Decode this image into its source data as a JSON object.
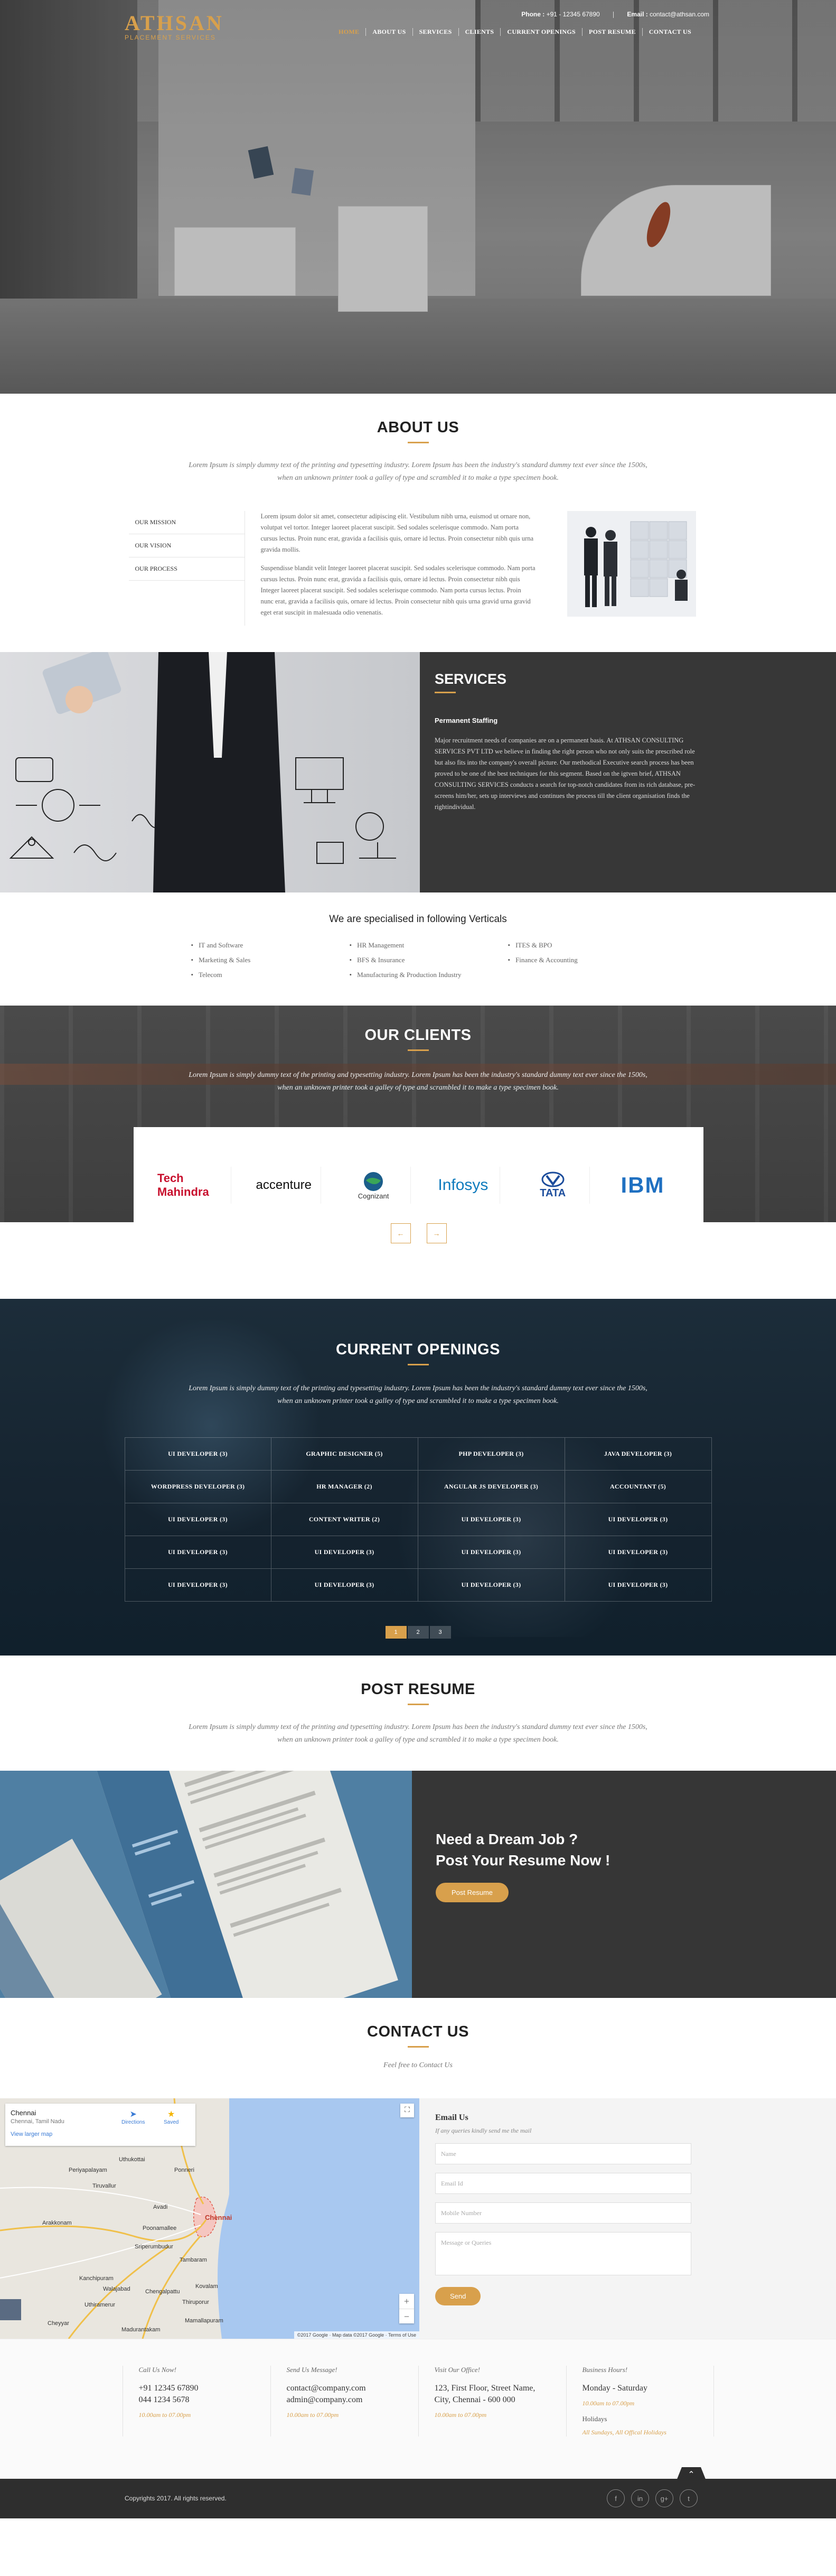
{
  "header": {
    "phone_label": "Phone :",
    "phone": "+91 - 12345 67890",
    "email_label": "Email :",
    "email": "contact@athsan.com",
    "brand": "ATHSAN",
    "tagline": "PLACEMENT SERVICES",
    "nav": [
      "HOME",
      "ABOUT US",
      "SERVICES",
      "CLIENTS",
      "CURRENT OPENINGS",
      "POST RESUME",
      "CONTACT US"
    ]
  },
  "about": {
    "title": "ABOUT US",
    "intro": "Lorem Ipsum is simply dummy text of the printing and typesetting industry. Lorem Ipsum has been the industry's standard dummy text ever since the 1500s, when an unknown printer took a galley of type and scrambled it to make a type specimen book.",
    "tabs": [
      "OUR MISSION",
      "OUR VISION",
      "OUR PROCESS"
    ],
    "para1": "Lorem ipsum dolor sit amet, consectetur adipiscing elit. Vestibulum nibh urna, euismod ut ornare non, volutpat vel tortor. Integer laoreet placerat suscipit. Sed sodales scelerisque commodo. Nam porta cursus lectus. Proin nunc erat, gravida a facilisis quis, ornare id lectus. Proin consectetur nibh quis urna gravida mollis.",
    "para2": "Suspendisse blandit velit Integer laoreet placerat suscipit. Sed sodales scelerisque commodo. Nam porta cursus lectus. Proin nunc erat, gravida a facilisis quis, ornare id lectus. Proin consectetur nibh quis Integer laoreet placerat suscipit. Sed sodales scelerisque commodo. Nam porta cursus lectus. Proin nunc erat, gravida a facilisis quis, ornare id lectus. Proin consectetur nibh quis urna gravid urna gravid eget erat suscipit in malesuada odio venenatis."
  },
  "services": {
    "title": "SERVICES",
    "subtitle": "Permanent Staffing",
    "text": "Major recruitment needs of companies are on a permanent basis. At ATHSAN CONSULTING SERVICES PVT LTD we believe in finding the right person who not only suits the prescribed role but also fits into the company's overall picture. Our methodical Executive search process has been proved to be one of the best techniques for this segment. Based on the  igtven brief, ATHSAN CONSULTING SERVICES conducts a search for top-notch candidates from its rich database, pre-screens him/her, sets up interviews and continues the process till the client organisation finds the rightindividual."
  },
  "verticals": {
    "title": "We are specialised in following Verticals",
    "items": [
      "IT and Software",
      "HR Management",
      "ITES & BPO",
      "Marketing & Sales",
      "BFS & Insurance",
      "Finance & Accounting",
      "Telecom",
      "Manufacturing & Production Industry"
    ]
  },
  "clients": {
    "title": "OUR CLIENTS",
    "intro": "Lorem Ipsum is simply dummy text of the printing and typesetting industry. Lorem Ipsum has been the industry's standard dummy text ever since the 1500s, when an unknown printer took a galley of type and scrambled it to make a type specimen book.",
    "logos": [
      "Tech Mahindra",
      "accenture",
      "Cognizant",
      "Infosys",
      "TATA",
      "IBM"
    ],
    "prev": "←",
    "next": "→"
  },
  "openings": {
    "title": "CURRENT OPENINGS",
    "intro": "Lorem Ipsum is simply dummy text of the printing and typesetting industry. Lorem Ipsum has been the industry's standard dummy text ever since the 1500s, when an unknown printer took a galley of type and scrambled it to make a type specimen book.",
    "jobs": [
      "UI DEVELOPER (3)",
      "GRAPHIC DESIGNER (5)",
      "PHP DEVELOPER (3)",
      "JAVA DEVELOPER (3)",
      "WORDPRESS DEVELOPER (3)",
      "HR MANAGER (2)",
      "ANGULAR JS DEVELOPER (3)",
      "ACCOUNTANT (5)",
      "UI DEVELOPER (3)",
      "CONTENT WRITER (2)",
      "UI DEVELOPER (3)",
      "UI DEVELOPER (3)",
      "UI DEVELOPER (3)",
      "UI DEVELOPER (3)",
      "UI DEVELOPER (3)",
      "UI DEVELOPER (3)",
      "UI DEVELOPER (3)",
      "UI DEVELOPER (3)",
      "UI DEVELOPER (3)",
      "UI DEVELOPER (3)"
    ],
    "pages": [
      "1",
      "2",
      "3"
    ]
  },
  "post_resume": {
    "title": "POST RESUME",
    "intro": "Lorem Ipsum is simply dummy text of the printing and typesetting industry. Lorem Ipsum has been the industry's standard dummy text ever since the 1500s, when an unknown printer took a galley of type and scrambled it to make a type specimen book.",
    "headline1": "Need a Dream Job ?",
    "headline2": "Post Your Resume Now !",
    "button": "Post Resume"
  },
  "contact": {
    "title": "CONTACT US",
    "subtitle": "Feel free to Contact Us",
    "map": {
      "place": "Chennai",
      "region": "Chennai, Tamil Nadu",
      "directions": "Directions",
      "saved": "Saved",
      "larger": "View larger map",
      "city_label": "Chennai",
      "credit": "©2017 Google · Map data ©2017 Google · Terms of Use",
      "towns": [
        "Tiruvallur",
        "Ponneri",
        "Avadi",
        "Poonamallee",
        "Sriperumbudur",
        "Tambaram",
        "Chengalpattu",
        "Kanchipuram",
        "Walajabad",
        "Cheyyar",
        "Arakkonam",
        "Uthukottai",
        "Kovalam",
        "Thiruporur",
        "Mamallapuram",
        "Madurantakam",
        "Uthiramerur",
        "Periyapalayam"
      ]
    },
    "form": {
      "title": "Email Us",
      "sub": "If any queries kindly send me the mail",
      "name": "Name",
      "email": "Email Id",
      "mobile": "Mobile Number",
      "message": "Message or Queries",
      "send": "Send"
    }
  },
  "footer": {
    "call_label": "Call Us Now!",
    "phone1": "+91 12345 67890",
    "phone2": "044 1234 5678",
    "call_hours": "10.00am to 07.00pm",
    "mail_label": "Send Us Message!",
    "email1": "contact@company.com",
    "email2": "admin@company.com",
    "mail_hours": "10.00am to 07.00pm",
    "visit_label": "Visit Our Office!",
    "address1": "123, First Floor, Street Name,",
    "address2": "City, Chennai - 600 000",
    "visit_hours": "10.00am to 07.00pm",
    "business_label": "Business Hours!",
    "days": "Monday - Saturday",
    "business_hours": "10.00am to 07.00pm",
    "holidays_label": "Holidays",
    "holidays": "All Sundays, All Offical Holidays",
    "copyright": "Copyrights 2017. All rights reserved.",
    "socials": [
      "f",
      "in",
      "g+",
      "t"
    ]
  },
  "colors": {
    "accent": "#d8a04c",
    "dark": "#363636"
  }
}
